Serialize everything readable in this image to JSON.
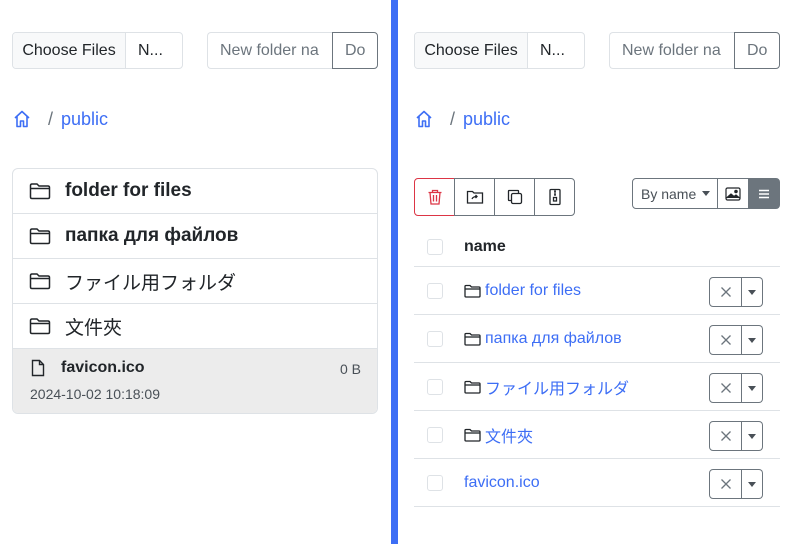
{
  "upload": {
    "choose_files_label": "Choose Files",
    "no_file_text": "N...",
    "folder_placeholder": "New folder na",
    "do_label": "Do"
  },
  "breadcrumb": {
    "separator": "/",
    "current": "public"
  },
  "left_list": {
    "folders": [
      {
        "label": "folder for files",
        "bold": true
      },
      {
        "label": "папка для файлов",
        "bold": true
      },
      {
        "label": "ファイル用フォルダ",
        "bold": false
      },
      {
        "label": "文件夾",
        "bold": false
      }
    ],
    "file": {
      "name": "favicon.ico",
      "size": "0 B",
      "modified": "2024-10-02 10:18:09"
    }
  },
  "right": {
    "sort_label": "By name",
    "table_header": "name",
    "rows": [
      {
        "label": "folder for files",
        "type": "folder"
      },
      {
        "label": "папка для файлов",
        "type": "folder"
      },
      {
        "label": "ファイル用フォルダ",
        "type": "folder"
      },
      {
        "label": "文件夾",
        "type": "folder"
      },
      {
        "label": "favicon.ico",
        "type": "file"
      }
    ]
  },
  "colors": {
    "accent": "#3d6ef5",
    "danger": "#dc3545",
    "border": "#dee2e6",
    "secondary": "#6c757d"
  },
  "icons": {
    "home": "home-icon",
    "folder": "folder-icon",
    "file": "file-icon",
    "trash": "trash-icon",
    "move": "folder-move-icon",
    "copy": "copy-icon",
    "zip": "zip-icon",
    "image_view": "image-view-icon",
    "list_view": "list-view-icon",
    "close": "close-icon",
    "caret": "chevron-down-icon"
  }
}
